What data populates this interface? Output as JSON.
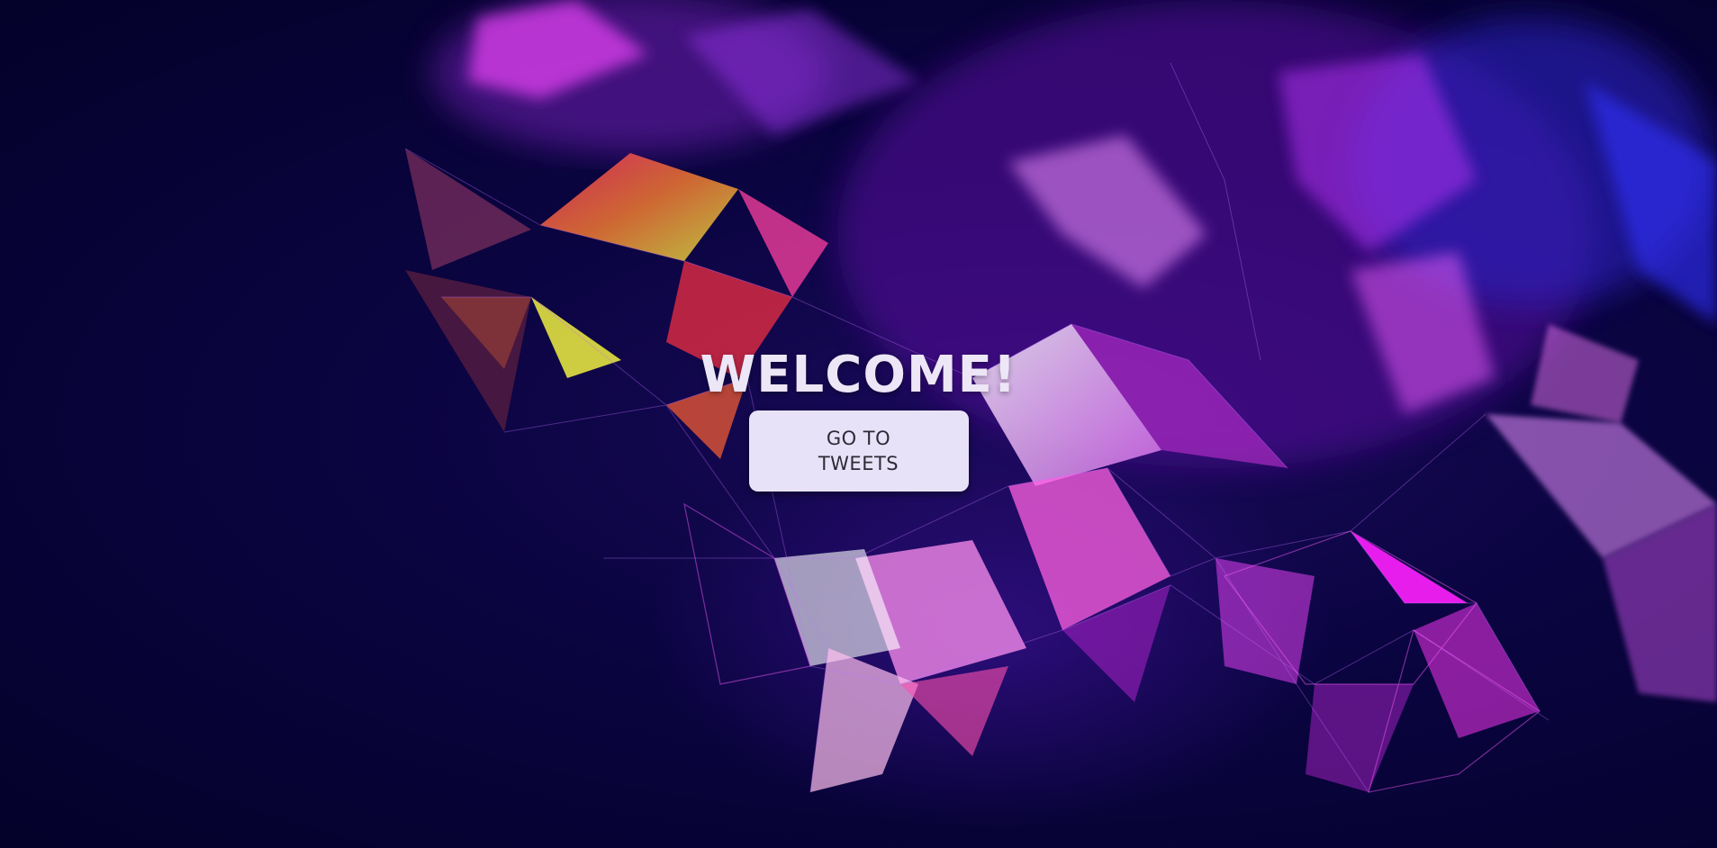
{
  "hero": {
    "title": "WELCOME!",
    "button_label": "GO TO\nTWEETS"
  },
  "colors": {
    "background": "#05022e",
    "title_text": "#ece6f6",
    "button_bg": "#e8e2f8",
    "button_text": "#2f2a36",
    "accent_magenta": "#e020e0",
    "accent_violet": "#8a2be2",
    "accent_yellow": "#f0e030",
    "accent_red": "#f03050"
  },
  "background_art": "abstract-low-poly-network"
}
